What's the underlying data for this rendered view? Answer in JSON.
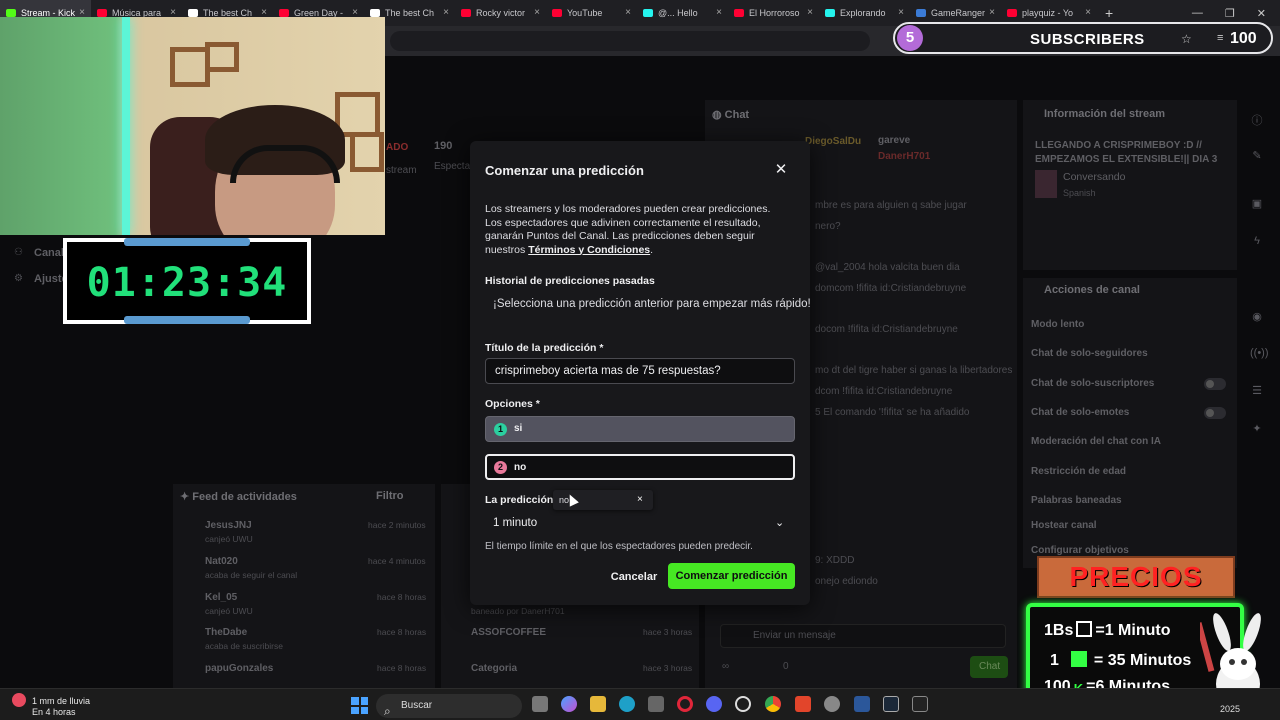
{
  "browser": {
    "tabs": [
      {
        "label": "Stream - Kick",
        "color": "#53fc18",
        "active": true
      },
      {
        "label": "Música para",
        "color": "#ff0033"
      },
      {
        "label": "The best Ch",
        "color": "#ffffff"
      },
      {
        "label": "Green Day -",
        "color": "#ff0033"
      },
      {
        "label": "The best Ch",
        "color": "#ffffff"
      },
      {
        "label": "Rocky victor",
        "color": "#ff0033"
      },
      {
        "label": "YouTube",
        "color": "#ff0033"
      },
      {
        "label": "@... Hello",
        "color": "#25f4ee"
      },
      {
        "label": "El Horroroso",
        "color": "#ff0033"
      },
      {
        "label": "Explorando",
        "color": "#25f4ee"
      },
      {
        "label": "GameRanger",
        "color": "#3b7bd6"
      },
      {
        "label": "playquiz - Yo",
        "color": "#ff0033"
      }
    ],
    "new_tab": "+"
  },
  "overlay": {
    "timer": "01:23:34",
    "subscribers": {
      "current": "5",
      "label": "SUBSCRIBERS",
      "goal": "100"
    }
  },
  "twitch": {
    "stream_stats": {
      "viewers": "190",
      "tag": "ADO"
    },
    "nav": {
      "canal": "Canal",
      "ajustes": "Ajustes"
    },
    "chat_title": "Chat",
    "chat_users": [
      "DiegoSalDu",
      "gareve",
      "DanerH701"
    ],
    "chat_lines": [
      "mbre es para alguien q sabe jugar",
      "nero?",
      "@val_2004 hola valcita buen dia",
      "domcom !fifita id:Cristiandebruyne",
      "docom !fifita id:Cristiandebruyne",
      "mo dt del tigre haber si ganas la libertadores",
      "dcom !fifita id:Cristiandebruyne",
      "5 El comando '!fifita' se ha añadido",
      "9: XDDD",
      "onejo ediondo"
    ],
    "chat_input_placeholder": "Enviar un mensaje",
    "chat_button": "Chat",
    "points": "0",
    "stream_info": {
      "heading": "Información del stream",
      "title": "LLEGANDO A CRISPRIMEBOY :D // EMPEZAMOS EL EXTENSIBLE!|| DIA 3 ...",
      "category": "Conversando",
      "language": "Spanish"
    },
    "channel_actions": {
      "heading": "Acciones de canal",
      "items": [
        "Modo lento",
        "Chat de solo-seguidores",
        "Chat de solo-suscriptores",
        "Chat de solo-emotes",
        "Moderación del chat con IA",
        "Restricción de edad",
        "Palabras baneadas",
        "Hostear canal",
        "Configurar objetivos"
      ]
    },
    "activity_feed": {
      "heading": "Feed de actividades",
      "filter": "Filtro",
      "items": [
        {
          "user": "JesusJNJ",
          "action": "canjeó UWU",
          "time": "hace 2 minutos"
        },
        {
          "user": "Nat020",
          "action": "acaba de seguir el canal",
          "time": "hace 4 minutos"
        },
        {
          "user": "Kel_05",
          "action": "canjeó UWU",
          "time": "hace 8 horas"
        },
        {
          "user": "TheDabe",
          "action": "acaba de suscribirse",
          "time": "hace 8 horas"
        },
        {
          "user": "papuGonzales",
          "action": "",
          "time": "hace 8 horas"
        }
      ]
    },
    "mod_log": [
      {
        "label": "baneado por DanerH701",
        "time": ""
      },
      {
        "label": "ASSOFCOFFEE",
        "time": "hace 3 horas"
      },
      {
        "label": "Categoria",
        "time": "hace 3 horas"
      }
    ]
  },
  "modal": {
    "title": "Comenzar una predicción",
    "description": "Los streamers y los moderadores pueden crear predicciones. Los espectadores que adivinen correctamente el resultado, ganarán Puntos del Canal. Las predicciones deben seguir nuestros",
    "terms_link": "Términos y Condiciones",
    "terms_suffix": ".",
    "history_label": "Historial de predicciones pasadas",
    "history_text": "¡Selecciona una predicción anterior para empezar más rápido!",
    "title_label": "Título de la predicción *",
    "title_value": "crisprimeboy acierta mas de 75 respuestas?",
    "options_label": "Opciones *",
    "options": [
      {
        "num": "1",
        "value": "si"
      },
      {
        "num": "2",
        "value": "no"
      }
    ],
    "duration_label": "La predicción c",
    "duration_value": "1 minuto",
    "duration_help": "El tiempo límite en el que los espectadores pueden predecir.",
    "cancel_label": "Cancelar",
    "submit_label": "Comenzar predicción",
    "tooltip_text": "no",
    "tooltip_close": "×"
  },
  "prices": {
    "banner": "PRECIOS",
    "rows": [
      {
        "amount": "1Bs",
        "icon": "qr-icon",
        "text": "=1 Minuto"
      },
      {
        "amount": "1",
        "icon": "kick-sub-icon",
        "text": "= 35 Minutos"
      },
      {
        "amount": "100",
        "icon": "kick-logo-icon",
        "text": "=6 Minutos"
      }
    ]
  },
  "taskbar": {
    "weather_title": "1 mm de lluvia",
    "weather_sub": "En 4 horas",
    "search_placeholder": "Buscar",
    "clock": "2025"
  },
  "colors": {
    "accent_green": "#46e823",
    "kick_green": "#53fc18",
    "modal_bg": "#18181b",
    "subs_badge": "#b36bd8",
    "timer_text": "#21e07a"
  }
}
